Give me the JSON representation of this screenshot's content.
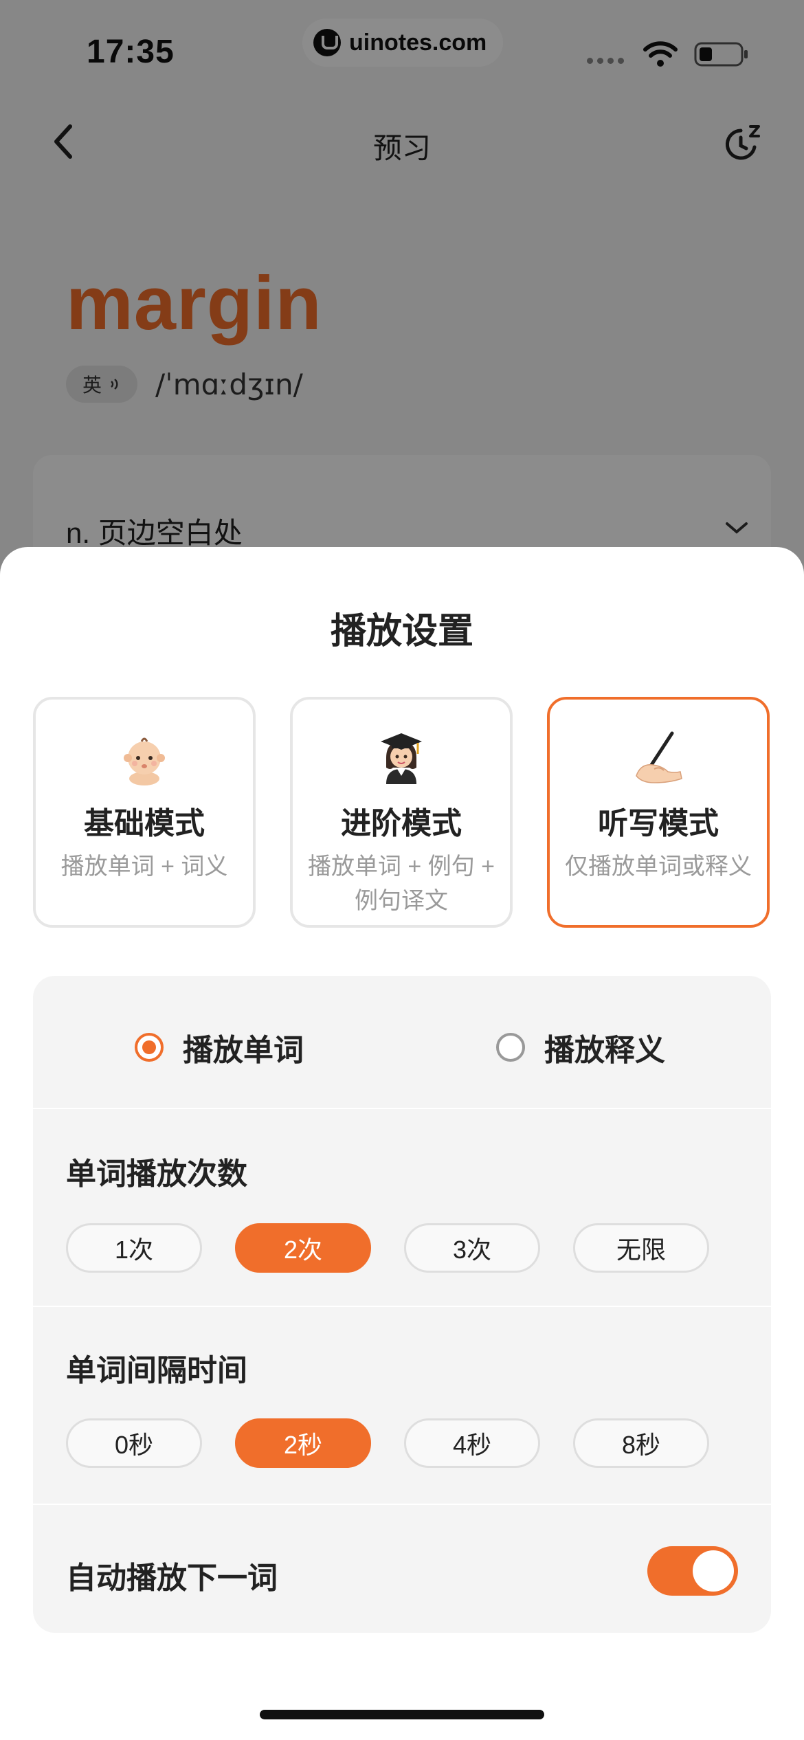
{
  "status_bar": {
    "time": "17:35",
    "url": "uinotes.com"
  },
  "nav": {
    "title": "预习"
  },
  "word": {
    "text": "margin",
    "accent_label": "英",
    "phonetic": "/ˈmɑːdʒɪn/"
  },
  "definition": {
    "text": "n. 页边空白处"
  },
  "sheet": {
    "title": "播放设置",
    "modes": [
      {
        "name": "基础模式",
        "desc": "播放单词 + 词义",
        "icon": "baby-emoji-icon",
        "selected": false
      },
      {
        "name": "进阶模式",
        "desc": "播放单词 + 例句 + 例句译文",
        "icon": "graduate-emoji-icon",
        "selected": false
      },
      {
        "name": "听写模式",
        "desc": "仅播放单词或释义",
        "icon": "writing-hand-emoji-icon",
        "selected": true
      }
    ],
    "play_options": [
      {
        "label": "播放单词",
        "checked": true
      },
      {
        "label": "播放释义",
        "checked": false
      }
    ],
    "repeat": {
      "label": "单词播放次数",
      "options": [
        "1次",
        "2次",
        "3次",
        "无限"
      ],
      "selected": "2次"
    },
    "interval": {
      "label": "单词间隔时间",
      "options": [
        "0秒",
        "2秒",
        "4秒",
        "8秒"
      ],
      "selected": "2秒"
    },
    "autoplay": {
      "label": "自动播放下一词",
      "enabled": true
    }
  },
  "colors": {
    "accent": "#f06e2b",
    "muted_text": "#9a9a9a",
    "panel": "#f4f4f4"
  }
}
